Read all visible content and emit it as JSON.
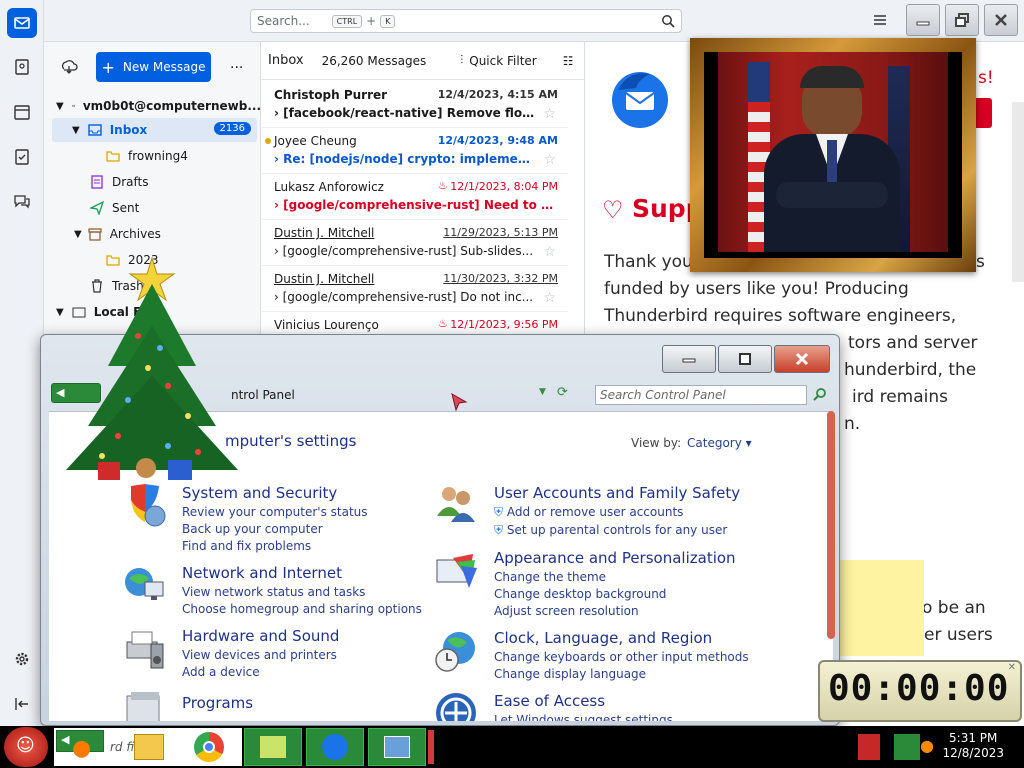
{
  "thunderbird": {
    "search": {
      "placeholder": "Search...",
      "key1": "CTRL",
      "plus": "+",
      "key2": "K"
    },
    "new_message": "New Message",
    "more": "...",
    "account": "vm0b0t@computernewb...",
    "folders": [
      {
        "label": "Inbox",
        "badge": "2136"
      },
      {
        "label": "frowning4"
      },
      {
        "label": "Drafts"
      },
      {
        "label": "Sent"
      },
      {
        "label": "Archives"
      },
      {
        "label": "2023"
      },
      {
        "label": "Trash"
      },
      {
        "label": "Local F"
      }
    ],
    "list": {
      "title": "Inbox",
      "count": "26,260 Messages",
      "quick_filter": "Quick Filter"
    },
    "messages": [
      {
        "from": "Christoph Purrer",
        "date": "12/4/2023, 4:15 AM",
        "subject": "[facebook/react-native] Remove flow ..."
      },
      {
        "from": "Joyee Cheung",
        "date": "12/4/2023, 9:48 AM",
        "subject": "Re: [nodejs/node] crypto: implement..."
      },
      {
        "from": "Lukasz Anforowicz",
        "date": "12/1/2023, 8:04 PM",
        "subject": "[google/comprehensive-rust] Need to co..."
      },
      {
        "from": "Dustin J. Mitchell",
        "date": "11/29/2023, 5:13 PM",
        "subject": "[google/comprehensive-rust] Sub-slides..."
      },
      {
        "from": "Dustin J. Mitchell",
        "date": "11/30/2023, 3:32 PM",
        "subject": "[google/comprehensive-rust] Do not inc..."
      },
      {
        "from": "Vinicius Lourenço",
        "date": "12/1/2023, 9:56 PM",
        "subject": ""
      }
    ],
    "reader": {
      "heading": "Supp",
      "exclaim": "s!",
      "lines": [
        "Thank you",
        "funded by users like you! Producing",
        "Thunderbird requires software engineers,",
        "tors and server",
        "hunderbird, the",
        "ird remains",
        "n.",
        "o be an",
        "er users"
      ],
      "line_end": "s"
    }
  },
  "control_panel": {
    "address": "ntrol Panel",
    "search_placeholder": "Search Control Panel",
    "heading": "mputer's settings",
    "view_by_label": "View by:",
    "view_by_value": "Category",
    "categories": [
      {
        "title": "System and Security",
        "links": [
          "Review your computer's status",
          "Back up your computer",
          "Find and fix problems"
        ]
      },
      {
        "title": "User Accounts and Family Safety",
        "links": [
          "Add or remove user accounts",
          "Set up parental controls for any user"
        ]
      },
      {
        "title": "Network and Internet",
        "links": [
          "View network status and tasks",
          "Choose homegroup and sharing options"
        ]
      },
      {
        "title": "Appearance and Personalization",
        "links": [
          "Change the theme",
          "Change desktop background",
          "Adjust screen resolution"
        ]
      },
      {
        "title": "Hardware and Sound",
        "links": [
          "View devices and printers",
          "Add a device"
        ]
      },
      {
        "title": "Clock, Language, and Region",
        "links": [
          "Change keyboards or other input methods",
          "Change display language"
        ]
      },
      {
        "title": "Programs",
        "links": []
      },
      {
        "title": "Ease of Access",
        "links": [
          "Let Windows suggest settings"
        ]
      }
    ]
  },
  "taskbar": {
    "partial_text": "rd files",
    "time": "5:31 PM",
    "date": "12/8/2023"
  },
  "stopwatch": {
    "display": "00:00:00"
  },
  "colors": {
    "accent": "#0060df",
    "unread_blue": "#0a58ca",
    "important_red": "#d70022",
    "cp_link": "#2a3f8a"
  }
}
